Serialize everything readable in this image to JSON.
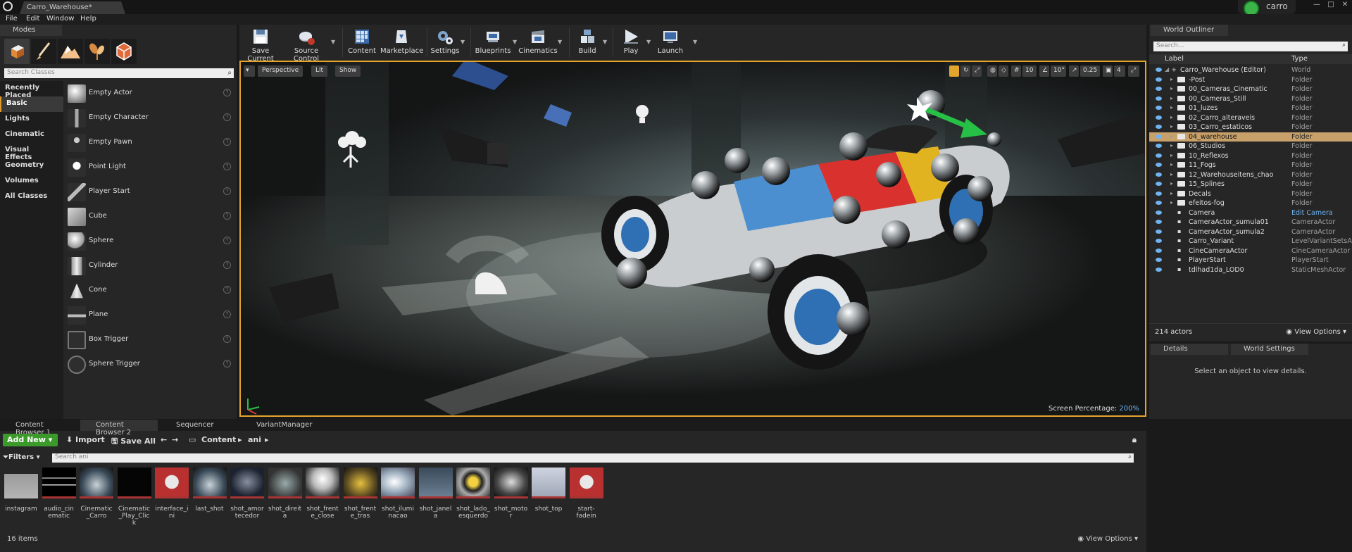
{
  "window": {
    "tab_title": "Carro_Warehouse*",
    "user": "carro",
    "controls": [
      "—",
      "□",
      "✕"
    ]
  },
  "menu": [
    "File",
    "Edit",
    "Window",
    "Help"
  ],
  "modes": {
    "tab_label": "Modes",
    "search_placeholder": "Search Classes",
    "categories": [
      "Recently Placed",
      "Basic",
      "Lights",
      "Cinematic",
      "Visual Effects",
      "Geometry",
      "Volumes",
      "All Classes"
    ],
    "active_category": "Basic",
    "actors": [
      "Empty Actor",
      "Empty Character",
      "Empty Pawn",
      "Point Light",
      "Player Start",
      "Cube",
      "Sphere",
      "Cylinder",
      "Cone",
      "Plane",
      "Box Trigger",
      "Sphere Trigger"
    ]
  },
  "toolbar": {
    "buttons": [
      "Save Current",
      "Source Control",
      "Content",
      "Marketplace",
      "Settings",
      "Blueprints",
      "Cinematics",
      "Build",
      "Play",
      "Launch"
    ]
  },
  "viewport": {
    "perspective": "Perspective",
    "lit": "Lit",
    "show": "Show",
    "grid_snap": "10",
    "rot_snap": "10°",
    "scale_snap": "0.25",
    "camera_speed": "4",
    "screen_percentage_label": "Screen Percentage:",
    "screen_percentage_value": "200%"
  },
  "outliner": {
    "tab_label": "World Outliner",
    "search_placeholder": "Search...",
    "col_label": "Label",
    "col_type": "Type",
    "rows": [
      {
        "label": "Carro_Warehouse (Editor)",
        "type": "World",
        "kind": "world"
      },
      {
        "label": "-Post",
        "type": "Folder",
        "kind": "folder"
      },
      {
        "label": "00_Cameras_Cinematic",
        "type": "Folder",
        "kind": "folder"
      },
      {
        "label": "00_Cameras_Still",
        "type": "Folder",
        "kind": "folder"
      },
      {
        "label": "01_luzes",
        "type": "Folder",
        "kind": "folder"
      },
      {
        "label": "02_Carro_alteraveis",
        "type": "Folder",
        "kind": "folder"
      },
      {
        "label": "03_Carro_estaticos",
        "type": "Folder",
        "kind": "folder"
      },
      {
        "label": "04_warehouse",
        "type": "Folder",
        "kind": "folder",
        "selected": true
      },
      {
        "label": "06_Studios",
        "type": "Folder",
        "kind": "folder"
      },
      {
        "label": "10_Reflexos",
        "type": "Folder",
        "kind": "folder"
      },
      {
        "label": "11_Fogs",
        "type": "Folder",
        "kind": "folder"
      },
      {
        "label": "12_Warehouseitens_chao",
        "type": "Folder",
        "kind": "folder"
      },
      {
        "label": "15_Splines",
        "type": "Folder",
        "kind": "folder"
      },
      {
        "label": "Decals",
        "type": "Folder",
        "kind": "folder"
      },
      {
        "label": "efeitos-fog",
        "type": "Folder",
        "kind": "folder"
      },
      {
        "label": "Camera",
        "type": "Edit Camera",
        "kind": "actor",
        "link": true
      },
      {
        "label": "CameraActor_sumula01",
        "type": "CameraActor",
        "kind": "actor"
      },
      {
        "label": "CameraActor_sumula2",
        "type": "CameraActor",
        "kind": "actor"
      },
      {
        "label": "Carro_Variant",
        "type": "LevelVariantSetsA",
        "kind": "actor"
      },
      {
        "label": "CineCameraActor",
        "type": "CineCameraActor",
        "kind": "actor"
      },
      {
        "label": "PlayerStart",
        "type": "PlayerStart",
        "kind": "actor"
      },
      {
        "label": "tdlhad1da_LOD0",
        "type": "StaticMeshActor",
        "kind": "actor"
      }
    ],
    "actor_count": "214 actors",
    "view_options": "View Options"
  },
  "details": {
    "tab_details": "Details",
    "tab_world_settings": "World Settings",
    "empty_message": "Select an object to view details."
  },
  "content_browser": {
    "tabs": [
      "Content Browser 1",
      "Content Browser 2",
      "Sequencer",
      "VariantManager"
    ],
    "add_new": "Add New",
    "import": "Import",
    "save_all": "Save All",
    "path": [
      "Content",
      "ani"
    ],
    "filters": "Filters",
    "search_placeholder": "Search ani",
    "assets": [
      {
        "name": "instagram",
        "kind": "folder"
      },
      {
        "name": "audio_cinematic",
        "kind": "audio"
      },
      {
        "name": "Cinematic_Carro",
        "kind": "car"
      },
      {
        "name": "Cinematic_Play_Click",
        "kind": "black"
      },
      {
        "name": "interface_ini",
        "kind": "seq"
      },
      {
        "name": "last_shot",
        "kind": "car"
      },
      {
        "name": "shot_amortecedor",
        "kind": "dark"
      },
      {
        "name": "shot_direita",
        "kind": "car2"
      },
      {
        "name": "shot_frente_close",
        "kind": "light"
      },
      {
        "name": "shot_frente_tras",
        "kind": "gold"
      },
      {
        "name": "shot_iluminacao",
        "kind": "bright"
      },
      {
        "name": "shot_janela",
        "kind": "blue"
      },
      {
        "name": "shot_lado_esquerdo",
        "kind": "wheel"
      },
      {
        "name": "shot_motor",
        "kind": "engine"
      },
      {
        "name": "shot_top",
        "kind": "top"
      },
      {
        "name": "start-fadein",
        "kind": "seq"
      }
    ],
    "item_count": "16 items",
    "view_options": "View Options"
  }
}
